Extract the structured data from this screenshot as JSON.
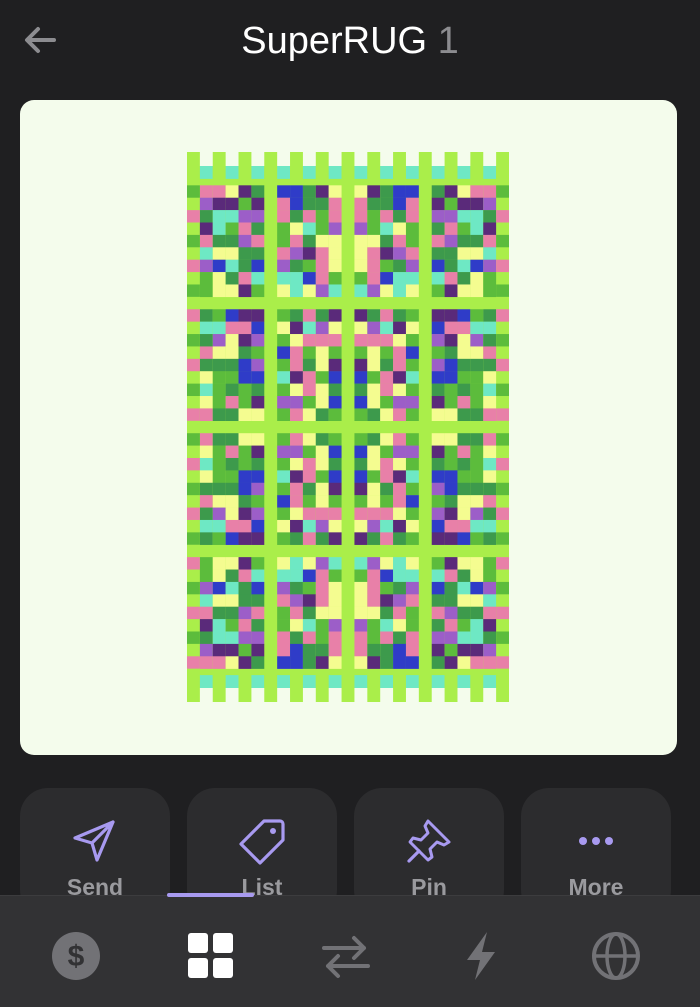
{
  "header": {
    "title": "SuperRUG",
    "number": "1"
  },
  "artwork": {
    "name": "rug-pixel-art",
    "colors": {
      "background": "#f4fcec",
      "lime": "#aaee4a",
      "green": "#5cbc3c",
      "dark_green": "#3d9a4c",
      "yellow": "#f4fc90",
      "pink": "#e880a8",
      "purple": "#9c5ec8",
      "dark_purple": "#5a2a7a",
      "blue": "#2f3cc8",
      "aqua": "#6ee8c4"
    }
  },
  "actions": [
    {
      "label": "Send",
      "icon": "send-icon"
    },
    {
      "label": "List",
      "icon": "tag-icon"
    },
    {
      "label": "Pin",
      "icon": "pin-icon"
    },
    {
      "label": "More",
      "icon": "more-icon"
    }
  ],
  "nav": [
    {
      "icon": "dollar-icon",
      "active": false
    },
    {
      "icon": "grid-icon",
      "active": true
    },
    {
      "icon": "swap-icon",
      "active": false
    },
    {
      "icon": "lightning-icon",
      "active": false
    },
    {
      "icon": "globe-icon",
      "active": false
    }
  ],
  "theme": {
    "accent": "#a89af0",
    "inactive_icon": "#727276",
    "active_icon": "#ffffff"
  }
}
